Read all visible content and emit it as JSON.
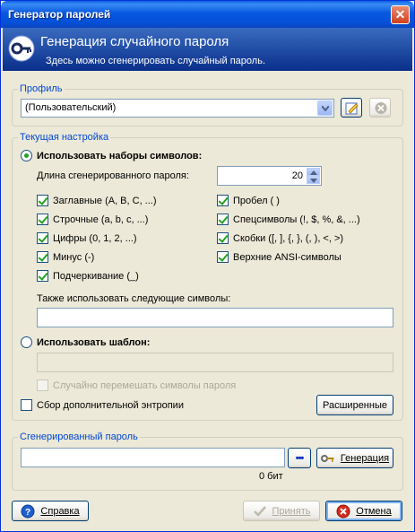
{
  "window": {
    "title": "Генератор паролей",
    "close_glyph": "✕"
  },
  "header": {
    "title": "Генерация случайного пароля",
    "subtitle": "Здесь можно сгенерировать случайный пароль."
  },
  "profile": {
    "legend": "Профиль",
    "selected": "(Пользовательский)"
  },
  "settings": {
    "legend": "Текущая настройка",
    "use_charsets_label": "Использовать наборы символов:",
    "length_label": "Длина сгенерированного пароля:",
    "length_value": "20",
    "charsets": [
      {
        "label": "Заглавные (A, B, C, ...)",
        "checked": true
      },
      {
        "label": "Пробел ( )",
        "checked": true
      },
      {
        "label": "Строчные (a, b, c, ...)",
        "checked": true
      },
      {
        "label": "Спецсимволы (!, $, %, &, ...)",
        "checked": true
      },
      {
        "label": "Цифры (0, 1, 2, ...)",
        "checked": true
      },
      {
        "label": "Скобки ([, ], {, }, (, ), <, >)",
        "checked": true
      },
      {
        "label": "Минус (-)",
        "checked": true
      },
      {
        "label": "Верхние ANSI-символы",
        "checked": true
      },
      {
        "label": "Подчеркивание (_)",
        "checked": true
      }
    ],
    "also_use_label": "Также использовать следующие символы:",
    "also_use_value": "",
    "use_pattern_label": "Использовать шаблон:",
    "pattern_value": "",
    "shuffle_label": "Случайно перемешать символы пароля",
    "entropy_label": "Сбор дополнительной энтропии",
    "advanced_button": "Расширенные"
  },
  "generated": {
    "legend": "Сгенерированный пароль",
    "value": "",
    "dots_label": "•••",
    "generate_button": "Генерация",
    "bits": "0 бит"
  },
  "footer": {
    "help_button": "Справка",
    "accept_button": "Принять",
    "cancel_button": "Отмена"
  },
  "colors": {
    "accent": "#0046d5",
    "check_green": "#21a121",
    "title_blue": "#0758e0"
  }
}
